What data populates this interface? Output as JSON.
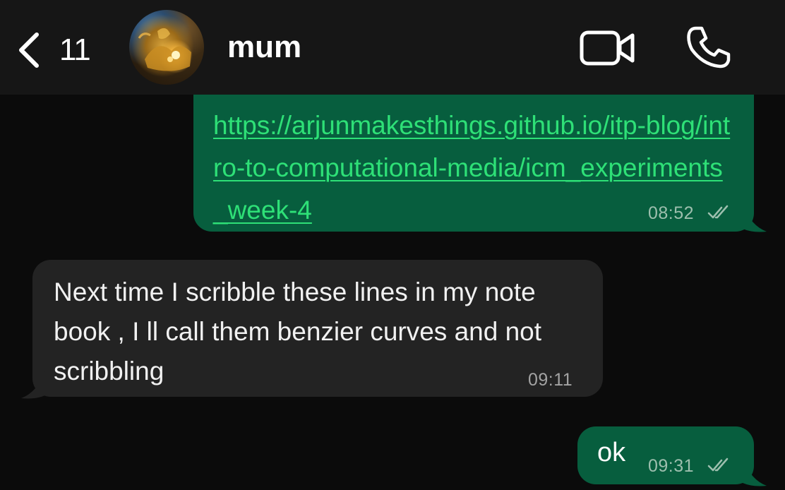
{
  "header": {
    "back_icon": "chevron-left-icon",
    "unread_count": "11",
    "contact_name": "mum",
    "video_icon": "video-camera-icon",
    "call_icon": "phone-icon",
    "avatar_icon": "avatar-photo"
  },
  "messages": [
    {
      "direction": "outgoing",
      "text": "https://arjunmakesthings.github.io/itp-blog/intro-to-computational-media/icm_experiments_week-4",
      "time": "08:52",
      "status_icon": "double-check-icon"
    },
    {
      "direction": "incoming",
      "text": "Next time I scribble these lines in my note book , I ll call them benzier curves and not scribbling",
      "time": "09:11"
    },
    {
      "direction": "outgoing",
      "text": "ok",
      "time": "09:31",
      "status_icon": "double-check-icon"
    }
  ],
  "colors": {
    "background": "#0b0b0b",
    "header_bg": "#161616",
    "outgoing_bubble": "#075e3e",
    "incoming_bubble": "#232323",
    "link": "#2ee077"
  }
}
